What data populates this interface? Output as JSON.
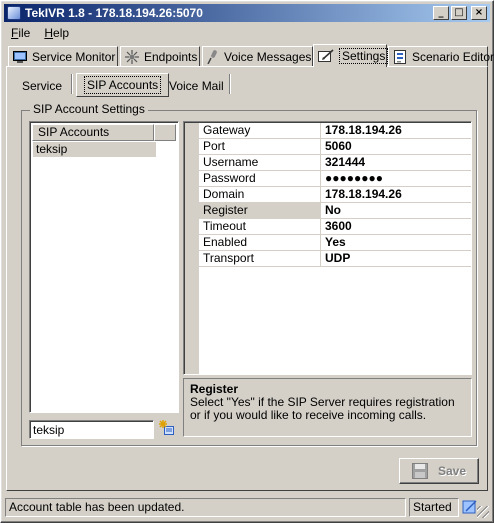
{
  "window": {
    "title": "TekIVR 1.8 - 178.18.194.26:5070",
    "controls": [
      "_",
      "□",
      "×"
    ]
  },
  "menu": [
    {
      "label": "File",
      "accel": "F",
      "rest": "ile"
    },
    {
      "label": "Help",
      "accel": "H",
      "rest": "elp"
    }
  ],
  "main_tabs": [
    {
      "label": "Service Monitor",
      "icon": "monitor-icon"
    },
    {
      "label": "Endpoints",
      "icon": "network-icon"
    },
    {
      "label": "Voice Messages",
      "icon": "microphone-icon"
    },
    {
      "label": "Settings",
      "icon": "settings-icon",
      "active": true
    },
    {
      "label": "Scenario Editor",
      "icon": "scenario-icon"
    }
  ],
  "sub_tabs": [
    {
      "label": "Service"
    },
    {
      "label": "SIP Accounts",
      "active": true
    },
    {
      "label": "Voice Mail"
    }
  ],
  "sip_group": {
    "title": "SIP Account Settings",
    "list_header": "SIP Accounts",
    "accounts": [
      "teksip"
    ],
    "input_value": "teksip"
  },
  "properties": [
    {
      "name": "Gateway",
      "value": "178.18.194.26"
    },
    {
      "name": "Port",
      "value": "5060"
    },
    {
      "name": "Username",
      "value": "321444"
    },
    {
      "name": "Password",
      "value": "●●●●●●●●"
    },
    {
      "name": "Domain",
      "value": "178.18.194.26"
    },
    {
      "name": "Register",
      "value": "No",
      "selected": true
    },
    {
      "name": "Timeout",
      "value": "3600"
    },
    {
      "name": "Enabled",
      "value": "Yes"
    },
    {
      "name": "Transport",
      "value": "UDP"
    }
  ],
  "description": {
    "title": "Register",
    "text": "Select \"Yes\" if the SIP Server requires registration or if you would like to receive incoming calls."
  },
  "buttons": {
    "save": "Save"
  },
  "status": {
    "message": "Account table has been updated.",
    "state": "Started"
  },
  "colors": {
    "face": "#d4d0c8",
    "title_start": "#0a246a",
    "title_end": "#a6caf0"
  }
}
